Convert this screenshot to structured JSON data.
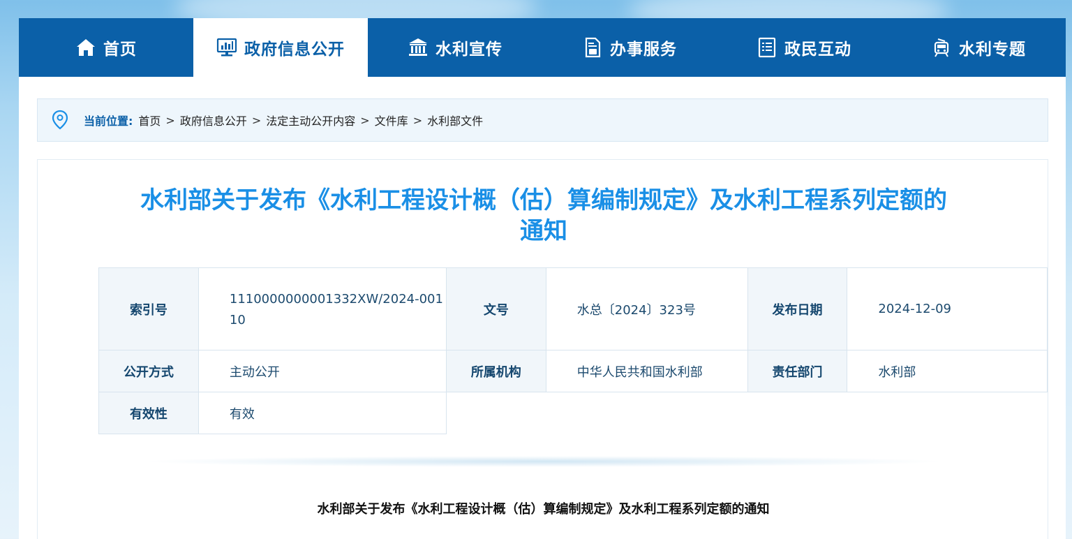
{
  "nav": {
    "items": [
      {
        "label": "首页",
        "icon": "home-icon",
        "active": false
      },
      {
        "label": "政府信息公开",
        "icon": "monitor-chart-icon",
        "active": true
      },
      {
        "label": "水利宣传",
        "icon": "building-icon",
        "active": false
      },
      {
        "label": "办事服务",
        "icon": "document-service-icon",
        "active": false
      },
      {
        "label": "政民互动",
        "icon": "list-doc-icon",
        "active": false
      },
      {
        "label": "水利专题",
        "icon": "train-icon",
        "active": false
      }
    ]
  },
  "breadcrumb": {
    "label": "当前位置:",
    "items": [
      "首页",
      "政府信息公开",
      "法定主动公开内容",
      "文件库",
      "水利部文件"
    ]
  },
  "article": {
    "title_line1": "水利部关于发布《水利工程设计概（估）算编制规定》及水利工程系列定额的",
    "title_line2": "通知",
    "meta": {
      "index_label": "索引号",
      "index_value": "1110000000001332XW/2024-00110",
      "docno_label": "文号",
      "docno_value": "水总〔2024〕323号",
      "date_label": "发布日期",
      "date_value": "2024-12-09",
      "method_label": "公开方式",
      "method_value": "主动公开",
      "org_label": "所属机构",
      "org_value": "中华人民共和国水利部",
      "dept_label": "责任部门",
      "dept_value": "水利部",
      "validity_label": "有效性",
      "validity_value": "有效"
    },
    "body_title": "水利部关于发布《水利工程设计概（估）算编制规定》及水利工程系列定额的通知"
  },
  "colors": {
    "nav_bg": "#0b60a8",
    "title": "#1a8fe6",
    "accent": "#0b60a8"
  }
}
